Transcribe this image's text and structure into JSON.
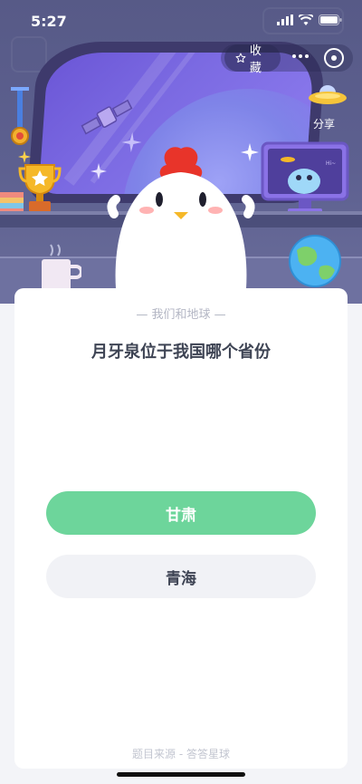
{
  "status_bar": {
    "time": "5:27"
  },
  "top_actions": {
    "favorite_label": "收藏",
    "share_label": "分享"
  },
  "quiz": {
    "category": "我们和地球",
    "question": "月牙泉位于我国哪个省份",
    "options": [
      {
        "label": "甘肃",
        "state": "selected"
      },
      {
        "label": "青海",
        "state": "default"
      }
    ],
    "source": "题目来源 - 答答星球"
  },
  "colors": {
    "scene_bg": "#5d6090",
    "correct_option": "#6dd59b",
    "default_option": "#f1f2f6",
    "question_text": "#3e4454"
  }
}
